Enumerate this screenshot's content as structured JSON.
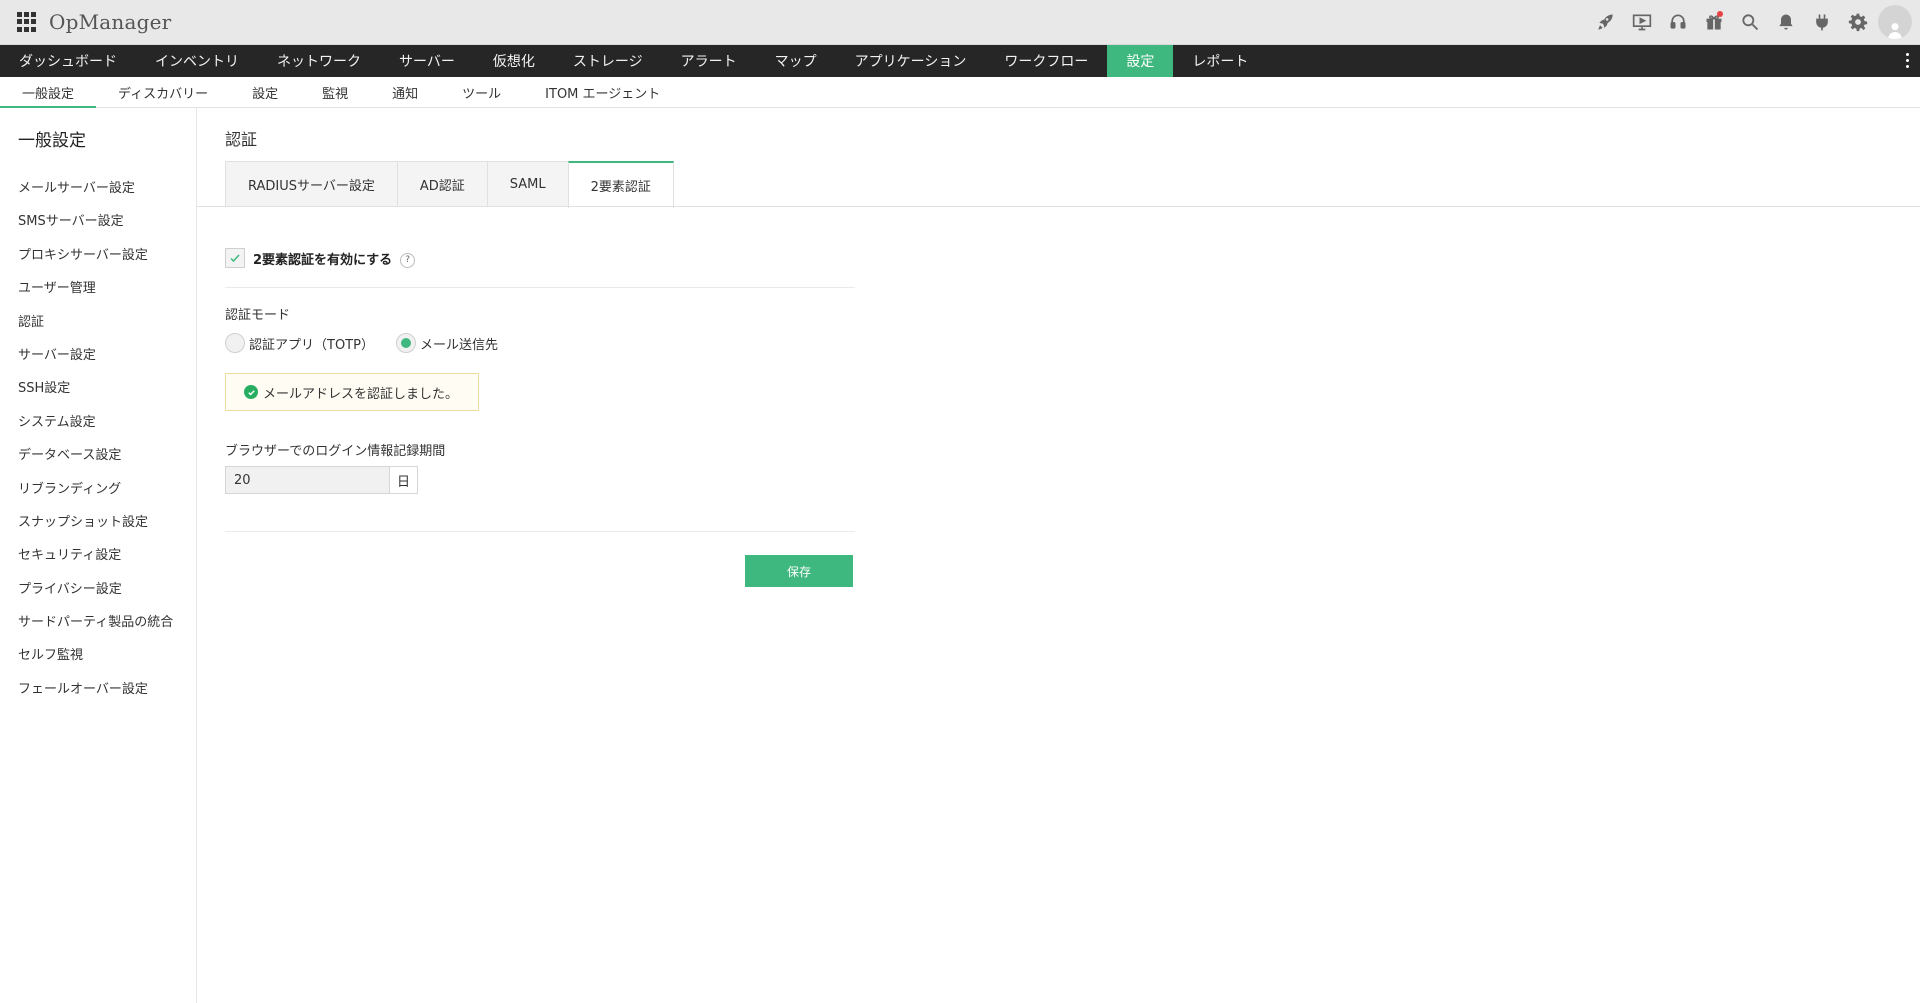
{
  "header": {
    "app_name": "OpManager",
    "icons": [
      "rocket-icon",
      "presentation-icon",
      "headset-icon",
      "gift-icon",
      "search-icon",
      "bell-icon",
      "plug-icon",
      "gear-icon",
      "user-avatar-icon"
    ]
  },
  "main_nav": {
    "items": [
      {
        "label": "ダッシュボード"
      },
      {
        "label": "インベントリ"
      },
      {
        "label": "ネットワーク"
      },
      {
        "label": "サーバー"
      },
      {
        "label": "仮想化"
      },
      {
        "label": "ストレージ"
      },
      {
        "label": "アラート"
      },
      {
        "label": "マップ"
      },
      {
        "label": "アプリケーション"
      },
      {
        "label": "ワークフロー"
      },
      {
        "label": "設定"
      },
      {
        "label": "レポート"
      }
    ],
    "active": "設定"
  },
  "sub_nav": {
    "items": [
      {
        "label": "一般設定"
      },
      {
        "label": "ディスカバリー"
      },
      {
        "label": "設定"
      },
      {
        "label": "監視"
      },
      {
        "label": "通知"
      },
      {
        "label": "ツール"
      },
      {
        "label": "ITOM エージェント"
      }
    ],
    "active": "一般設定"
  },
  "sidebar": {
    "title": "一般設定",
    "items": [
      {
        "label": "メールサーバー設定"
      },
      {
        "label": "SMSサーバー設定"
      },
      {
        "label": "プロキシサーバー設定"
      },
      {
        "label": "ユーザー管理"
      },
      {
        "label": "認証"
      },
      {
        "label": "サーバー設定"
      },
      {
        "label": "SSH設定"
      },
      {
        "label": "システム設定"
      },
      {
        "label": "データベース設定"
      },
      {
        "label": "リブランディング"
      },
      {
        "label": "スナップショット設定"
      },
      {
        "label": "セキュリティ設定"
      },
      {
        "label": "プライバシー設定"
      },
      {
        "label": "サードパーティ製品の統合"
      },
      {
        "label": "セルフ監視"
      },
      {
        "label": "フェールオーバー設定"
      }
    ]
  },
  "content": {
    "title": "認証",
    "tabs": [
      {
        "label": "RADIUSサーバー設定"
      },
      {
        "label": "AD認証"
      },
      {
        "label": "SAML"
      },
      {
        "label": "2要素認証"
      }
    ],
    "active_tab": "2要素認証",
    "enable_2fa": {
      "label": "2要素認証を有効にする",
      "checked": true,
      "help": "?"
    },
    "auth_mode": {
      "label": "認証モード",
      "options": [
        {
          "label": "認証アプリ（TOTP）",
          "selected": false
        },
        {
          "label": "メール送信先",
          "selected": true
        }
      ]
    },
    "notice": "メールアドレスを認証しました。",
    "retention": {
      "label": "ブラウザーでのログイン情報記録期間",
      "value": "20",
      "unit": "日"
    },
    "save_label": "保存"
  },
  "colors": {
    "accent": "#3fb87f",
    "nav_bg": "#262626",
    "header_bg": "#e8e8e8",
    "notice_bg": "#fffdf3",
    "notice_border": "#f1dca2"
  }
}
